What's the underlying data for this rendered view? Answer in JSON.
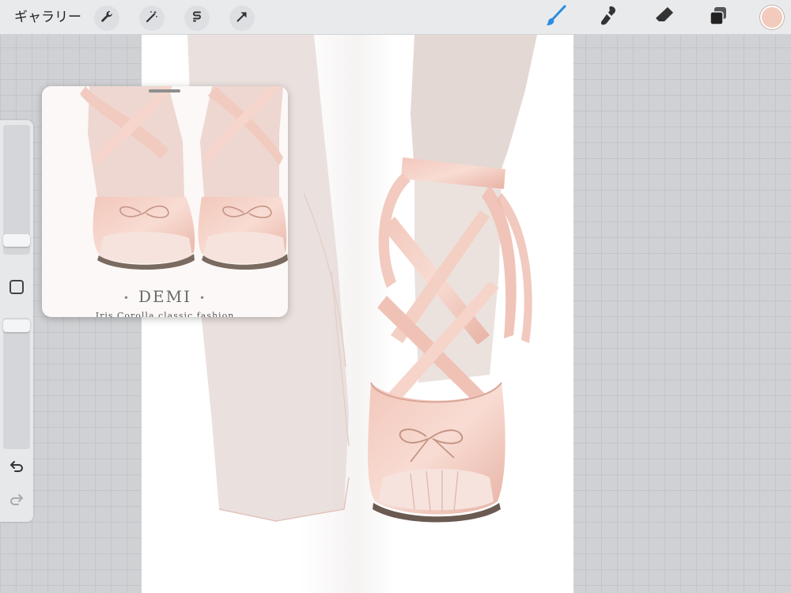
{
  "toolbar": {
    "gallery_label": "ギャラリー",
    "left_tools": [
      "wrench-icon",
      "magic-wand-icon",
      "selection-icon",
      "transform-arrow-icon"
    ],
    "right_tools": [
      "brush-icon",
      "smudge-icon",
      "eraser-icon",
      "layers-icon"
    ],
    "active_tool": "brush-icon",
    "accent_color": "#2a8ee0",
    "current_color": "#f2cbbd"
  },
  "sidebar": {
    "brush_size_level": 0.84,
    "opacity_level": 0.0,
    "undo_icon": "undo-icon",
    "redo_icon": "redo-icon"
  },
  "reference": {
    "brand": "DEMI",
    "tagline": "Iris Corolla classic fashion"
  },
  "canvas": {
    "background": "#ffffff",
    "subject": "ballet-flat-shoe-drawing"
  }
}
